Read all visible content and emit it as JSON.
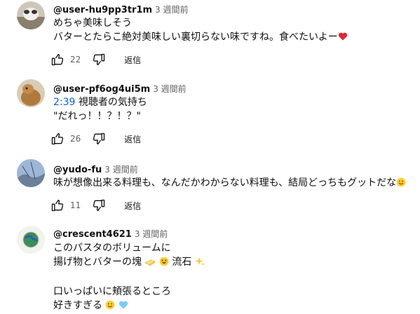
{
  "comments": [
    {
      "author": "@user-hu9pp3tr1m",
      "time": "3 週間前",
      "lines": [
        "めちゃ美味しそう",
        "バターとたらこ絶対美味しい裏切らない味ですね。食べたいよー"
      ],
      "likes": "22",
      "reply": "返信"
    },
    {
      "author": "@user-pf6og4ui5m",
      "time": "3 週間前",
      "timestamp_link": "2:39",
      "lines": [
        " 視聴者の気持ち",
        "\"だれっ！！？！？\""
      ],
      "likes": "26",
      "reply": "返信"
    },
    {
      "author": "@yudo-fu",
      "time": "3 週間前",
      "lines": [
        "味が想像出来る料理も、なんだかわからない料理も、結局どっちもグットだな"
      ],
      "likes": "11",
      "reply": "返信"
    },
    {
      "author": "@crescent4621",
      "time": "3 週間前",
      "lines": [
        "このパスタのボリュームに",
        "揚げ物とバターの塊",
        "流石",
        "口いっぱいに頬張るところ",
        "好きすぎる"
      ]
    }
  ]
}
